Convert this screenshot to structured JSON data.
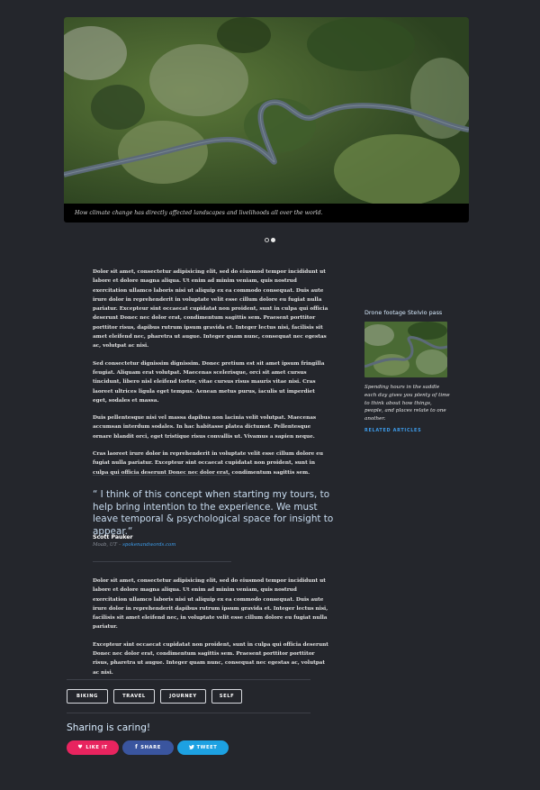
{
  "hero": {
    "caption": "How climate change has directly affected landscapes and livelihoods all over the world.",
    "dots": [
      {
        "active": false
      },
      {
        "active": true
      }
    ]
  },
  "article": {
    "p1": "Dolor sit amet, consectetur adipisicing elit, sed do eiusmod tempor incididunt ut labore et dolore magna aliqua. Ut enim ad minim veniam, quis nostrud exercitation ullamco laboris nisi ut aliquip ex ea commodo consequat. Duis aute irure dolor in reprehenderit in voluptate velit esse cillum dolore eu fugiat nulla pariatur. Excepteur sint occaecat cupidatat non proident, sunt in culpa qui officia deserunt Donec nec dolor erat, condimentum sagittis sem. Praesent porttitor porttitor risus, dapibus rutrum ipsum gravida et. Integer lectus nisi, facilisis sit amet eleifend nec, pharetra ut augue. Integer quam nunc, consequat nec egestas ac, volutpat ac nisi.",
    "p2": "Sed consectetur dignissim dignissim. Donec pretium est sit amet ipsum fringilla feugiat. Aliquam erat volutpat. Maecenas scelerisque, orci sit amet cursus tincidunt, libero nisl eleifend tortor, vitae cursus risus mauris vitae nisi. Cras laoreet ultrices ligula eget tempus. Aenean metus purus, iaculis ut imperdiet eget, sodales et massa.",
    "p3": "Duis pellentesque nisi vel massa dapibus non lacinia velit volutpat. Maecenas accumsan interdum sodales. In hac habitasse platea dictumst. Pellentesque ornare blandit orci, eget tristique risus convallis ut. Vivamus a sapien neque.",
    "p4": "Cras laoreet irure dolor in reprehenderit in voluptate velit esse cillum dolore eu fugiat nulla pariatur. Excepteur sint occaecat cupidatat non proident, sunt in culpa qui officia deserunt Donec nec dolor erat, condimentum sagittis sem.",
    "p5": "Dolor sit amet, consectetur adipisicing elit, sed do eiusmod tempor incididunt ut labore et dolore magna aliqua. Ut enim ad minim veniam, quis nostrud exercitation ullamco laboris nisi ut aliquip ex ea commodo consequat. Duis aute irure dolor in reprehenderit dapibus rutrum ipsum gravida et. Integer lectus nisi, facilisis sit amet eleifend nec, in voluptate velit esse cillum dolore eu fugiat nulla pariatur.",
    "p6": "Excepteur sint occaecat cupidatat non proident, sunt in culpa qui officia deserunt Donec nec dolor erat, condimentum sagittis sem. Praesent porttitor porttitor risus, pharetra ut augue. Integer quam nunc, consequat nec egestas ac, volutpat ac nisi."
  },
  "quote": {
    "text": "“ I think of this concept when starting my tours, to help bring intention to the experience. We must leave temporal & psychological space for insight to appear.“",
    "author": "Scott Pauker",
    "meta_prefix": "Moab, UT –",
    "meta_link": "spokenandwords.com"
  },
  "tags": [
    "BIKING",
    "TRAVEL",
    "JOURNEY",
    "SELF"
  ],
  "share": {
    "title": "Sharing is caring!",
    "like_label": "LIKE IT",
    "share_label": "SHARE",
    "tweet_label": "TWEET",
    "colors": {
      "like": "#e8245f",
      "share": "#3a559f",
      "tweet": "#1da1e2"
    }
  },
  "sidebar": {
    "title": "Drone footage Stelvio pass",
    "text": "Spending hours in the saddle each day gives you plenty of time to think about how things, people, and places relate to one another.",
    "link": "RELATED ARTICLES"
  },
  "colors": {
    "background": "#24262c",
    "accent": "#3d9be9"
  }
}
